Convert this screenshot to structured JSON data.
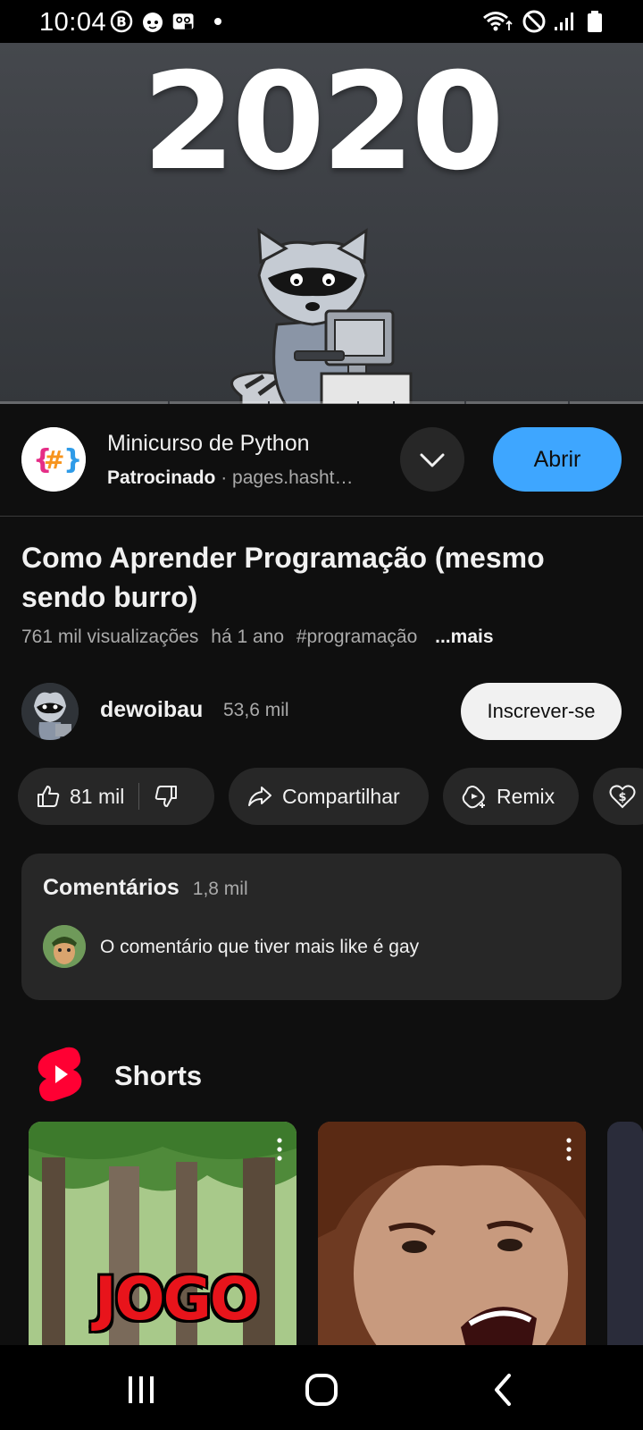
{
  "status_bar": {
    "time": "10:04",
    "icons": [
      "b-badge-icon",
      "face-notification-icon",
      "voicemail-icon",
      "notification-dot-icon",
      "wifi-icon",
      "do-not-disturb-icon",
      "signal-icon",
      "battery-icon"
    ]
  },
  "video": {
    "overlay_text": "2020"
  },
  "ad": {
    "title": "Minicurso de Python",
    "sponsored": "Patrocinado",
    "separator": "·",
    "domain": "pages.hasht…",
    "open_label": "Abrir",
    "logo_text": "{#}"
  },
  "video_info": {
    "title": "Como Aprender Programação (mesmo sendo burro)",
    "views": "761 mil visualizações",
    "age": "há 1 ano",
    "hashtag": "#programação",
    "more": "...mais"
  },
  "channel": {
    "name": "dewoibau",
    "subscribers": "53,6 mil",
    "subscribe_label": "Inscrever-se"
  },
  "actions": {
    "likes": "81 mil",
    "share": "Compartilhar",
    "remix": "Remix"
  },
  "comments": {
    "heading": "Comentários",
    "count": "1,8 mil",
    "top_comment": "O comentário que tiver mais like é gay"
  },
  "shorts": {
    "heading": "Shorts",
    "items": [
      {
        "overlay_text": "JOGO"
      },
      {
        "overlay_text": ""
      }
    ]
  },
  "colors": {
    "background": "#0f0f0f",
    "accent_blue": "#3ea6ff",
    "shorts_red": "#ff0033",
    "surface": "#272727"
  }
}
